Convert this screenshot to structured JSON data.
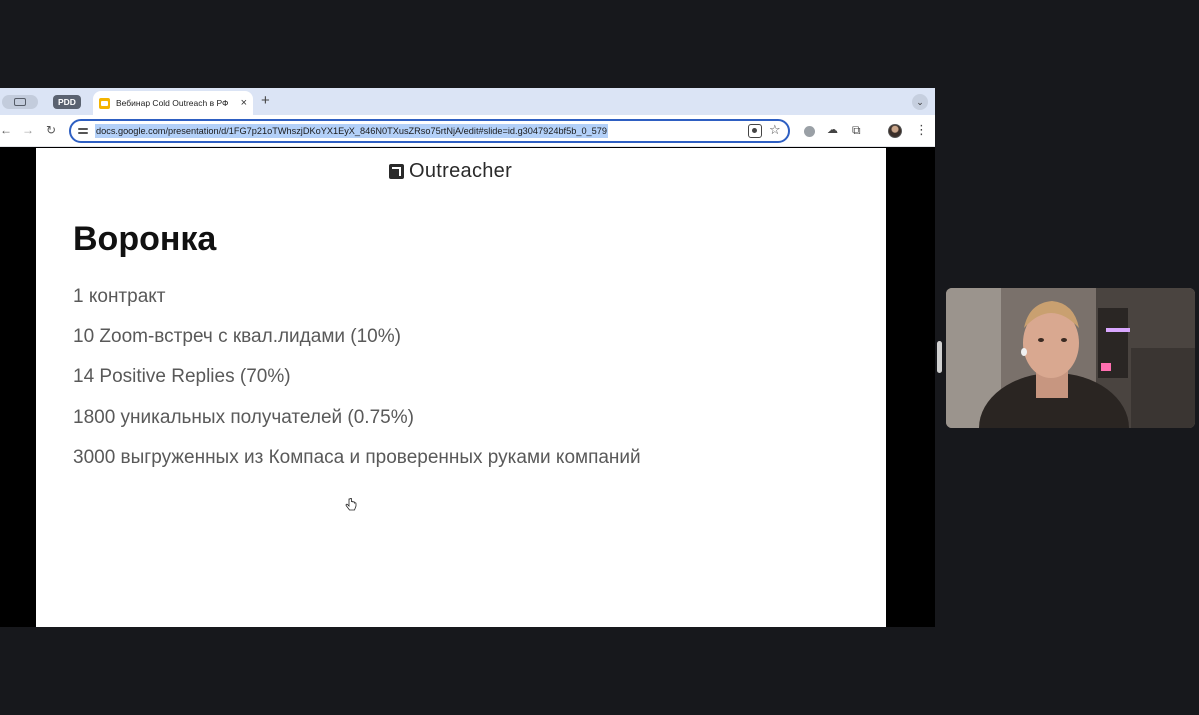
{
  "browser": {
    "tabs": {
      "pinned_label": "PDD",
      "active_title": "Вебинар Cold Outreach в РФ",
      "close_glyph": "×",
      "new_tab_glyph": "+"
    },
    "toolbar": {
      "back_glyph": "←",
      "forward_glyph": "→",
      "reload_glyph": "↻",
      "url": "docs.google.com/presentation/d/1FG7p21oTWhszjDKoYX1EyX_846N0TXusZRso75rtNjA/edit#slide=id.g3047924bf5b_0_579",
      "star_glyph": "☆",
      "menu_glyph": "⋮",
      "tab_search_glyph": "⌄"
    }
  },
  "slide": {
    "brand": "Outreacher",
    "heading": "Воронка",
    "items": [
      "1 контракт",
      "10 Zoom-встреч с квал.лидами (10%)",
      "14 Positive Replies (70%)",
      "1800 уникальных получателей (0.75%)",
      "3000 выгруженных из Компаса и проверенных руками компаний"
    ]
  },
  "colors": {
    "tabbar_bg": "#dbe4f5",
    "omnibox_focus": "#2e5fc2",
    "url_selection": "#b3d0f8",
    "page_bg": "#17181c"
  }
}
